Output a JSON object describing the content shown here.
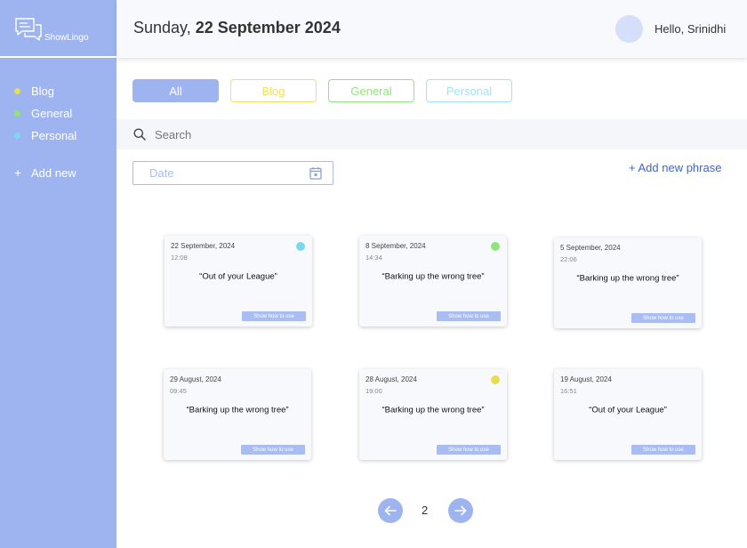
{
  "app": {
    "name": "ShowLingo"
  },
  "sidebar": {
    "items": [
      {
        "label": "Blog",
        "color": "#e8dd50"
      },
      {
        "label": "General",
        "color": "#8fe57a"
      },
      {
        "label": "Personal",
        "color": "#7ad9f0"
      }
    ],
    "add_new_label": "Add new",
    "add_icon": "+"
  },
  "header": {
    "day": "Sunday,",
    "date": "22 September 2024",
    "greeting": "Hello, Srinidhi"
  },
  "filters": {
    "tabs": [
      {
        "label": "All",
        "active": true,
        "color": "#9db4f1"
      },
      {
        "label": "Blog",
        "active": false,
        "color": "#f0e25e"
      },
      {
        "label": "General",
        "active": false,
        "color": "#8fe57a"
      },
      {
        "label": "Personal",
        "active": false,
        "color": "#9fe3f5"
      }
    ]
  },
  "search": {
    "placeholder": "Search",
    "value": ""
  },
  "date_filter": {
    "label": "Date"
  },
  "add_phrase_label": "+ Add new phrase",
  "cards": [
    {
      "date": "22 September, 2024",
      "time": "12:08",
      "phrase": "“Out of your League”",
      "tag_color": "#7ad9f0",
      "button": "Show how to use"
    },
    {
      "date": "8 September, 2024",
      "time": "14:34",
      "phrase": "“Barking up the wrong tree”",
      "tag_color": "#8fe57a",
      "button": "Show how to use"
    },
    {
      "date": "5 September, 2024",
      "time": "22:06",
      "phrase": "“Barking up the wrong tree”",
      "tag_color": null,
      "button": "Show how to use"
    },
    {
      "date": "29 August, 2024",
      "time": "09:45",
      "phrase": "“Barking up the wrong tree”",
      "tag_color": null,
      "button": "Show how to use"
    },
    {
      "date": "28 August, 2024",
      "time": "19:00",
      "phrase": "“Barking up the wrong tree”",
      "tag_color": "#e8dd50",
      "button": "Show how to use"
    },
    {
      "date": "19 August, 2024",
      "time": "16:51",
      "phrase": "“Out of your League”",
      "tag_color": null,
      "button": "Show how to use"
    }
  ],
  "pagination": {
    "current_page": "2",
    "prev_icon": "arrow-left-icon",
    "next_icon": "arrow-right-icon"
  },
  "colors": {
    "accent": "#9db4f1",
    "link": "#4064c8",
    "header_bg": "#f8f9fc"
  }
}
